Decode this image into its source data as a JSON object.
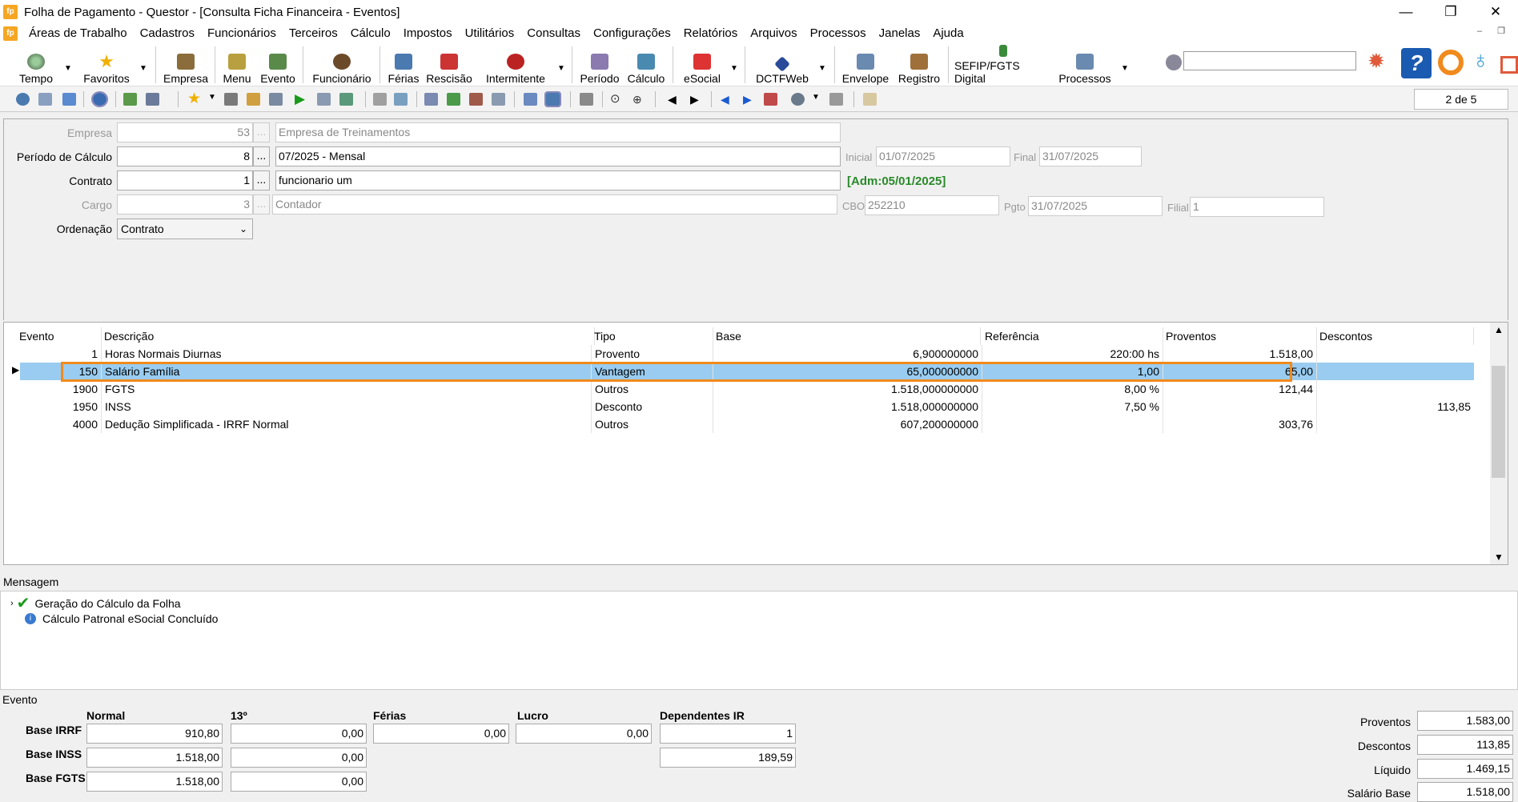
{
  "window": {
    "title": "Folha de Pagamento - Questor - [Consulta Ficha Financeira - Eventos]",
    "app_icon_text": "fp"
  },
  "menu": [
    "Áreas de Trabalho",
    "Cadastros",
    "Funcionários",
    "Terceiros",
    "Cálculo",
    "Impostos",
    "Utilitários",
    "Consultas",
    "Configurações",
    "Relatórios",
    "Arquivos",
    "Processos",
    "Janelas",
    "Ajuda"
  ],
  "toolbar": {
    "tempo": "Tempo",
    "favoritos": "Favoritos",
    "empresa": "Empresa",
    "menu": "Menu",
    "evento": "Evento",
    "funcionario": "Funcionário",
    "ferias": "Férias",
    "rescisao": "Rescisão",
    "intermitente": "Intermitente",
    "periodo": "Período",
    "calculo": "Cálculo",
    "esocial": "eSocial",
    "dctfweb": "DCTFWeb",
    "envelope": "Envelope",
    "registro": "Registro",
    "sefip": "SEFIP/FGTS Digital",
    "processos": "Processos",
    "search_value": ""
  },
  "pager": "2 de 5",
  "form": {
    "empresa_label": "Empresa",
    "empresa_code": "53",
    "empresa_name": "Empresa de Treinamentos",
    "periodo_label": "Período de Cálculo",
    "periodo_code": "8",
    "periodo_name": "07/2025 - Mensal",
    "inicial_label": "Inicial",
    "inicial_value": "01/07/2025",
    "final_label": "Final",
    "final_value": "31/07/2025",
    "contrato_label": "Contrato",
    "contrato_code": "1",
    "contrato_name": "funcionario um",
    "adm": "[Adm:05/01/2025]",
    "cargo_label": "Cargo",
    "cargo_code": "3",
    "cargo_name": "Contador",
    "cbo_label": "CBO",
    "cbo_value": "252210",
    "pgto_label": "Pgto",
    "pgto_value": "31/07/2025",
    "filial_label": "Filial",
    "filial_value": "1",
    "ordenacao_label": "Ordenação",
    "ordenacao_value": "Contrato"
  },
  "grid": {
    "headers": {
      "evento": "Evento",
      "descricao": "Descrição",
      "tipo": "Tipo",
      "base": "Base",
      "referencia": "Referência",
      "proventos": "Proventos",
      "descontos": "Descontos"
    },
    "rows": [
      {
        "evento": "1",
        "descricao": "Horas Normais Diurnas",
        "tipo": "Provento",
        "base": "6,900000000",
        "referencia": "220:00 hs",
        "proventos": "1.518,00",
        "descontos": ""
      },
      {
        "evento": "150",
        "descricao": "Salário Família",
        "tipo": "Vantagem",
        "base": "65,000000000",
        "referencia": "1,00",
        "proventos": "65,00",
        "descontos": ""
      },
      {
        "evento": "1900",
        "descricao": "FGTS",
        "tipo": "Outros",
        "base": "1.518,000000000",
        "referencia": "8,00 %",
        "proventos": "121,44",
        "descontos": ""
      },
      {
        "evento": "1950",
        "descricao": "INSS",
        "tipo": "Desconto",
        "base": "1.518,000000000",
        "referencia": "7,50 %",
        "proventos": "",
        "descontos": "113,85"
      },
      {
        "evento": "4000",
        "descricao": "Dedução Simplificada - IRRF Normal",
        "tipo": "Outros",
        "base": "607,200000000",
        "referencia": "",
        "proventos": "303,76",
        "descontos": ""
      }
    ]
  },
  "messages": {
    "title": "Mensagem",
    "items": [
      "Geração do Cálculo da Folha",
      "Cálculo Patronal eSocial Concluído"
    ]
  },
  "evento_panel": {
    "title": "Evento",
    "col_normal": "Normal",
    "col_13": "13º",
    "col_ferias": "Férias",
    "col_lucro": "Lucro",
    "col_dep": "Dependentes IR",
    "base_irrf_label": "Base IRRF",
    "base_inss_label": "Base INSS",
    "base_fgts_label": "Base FGTS",
    "irrf_normal": "910,80",
    "irrf_13": "0,00",
    "irrf_ferias": "0,00",
    "irrf_lucro": "0,00",
    "dep_ir": "1",
    "inss_normal": "1.518,00",
    "inss_13": "0,00",
    "dep_val": "189,59",
    "fgts_normal": "1.518,00",
    "fgts_13": "0,00"
  },
  "totals": {
    "proventos_label": "Proventos",
    "proventos": "1.583,00",
    "descontos_label": "Descontos",
    "descontos": "113,85",
    "liquido_label": "Líquido",
    "liquido": "1.469,15",
    "salario_label": "Salário Base",
    "salario": "1.518,00"
  }
}
